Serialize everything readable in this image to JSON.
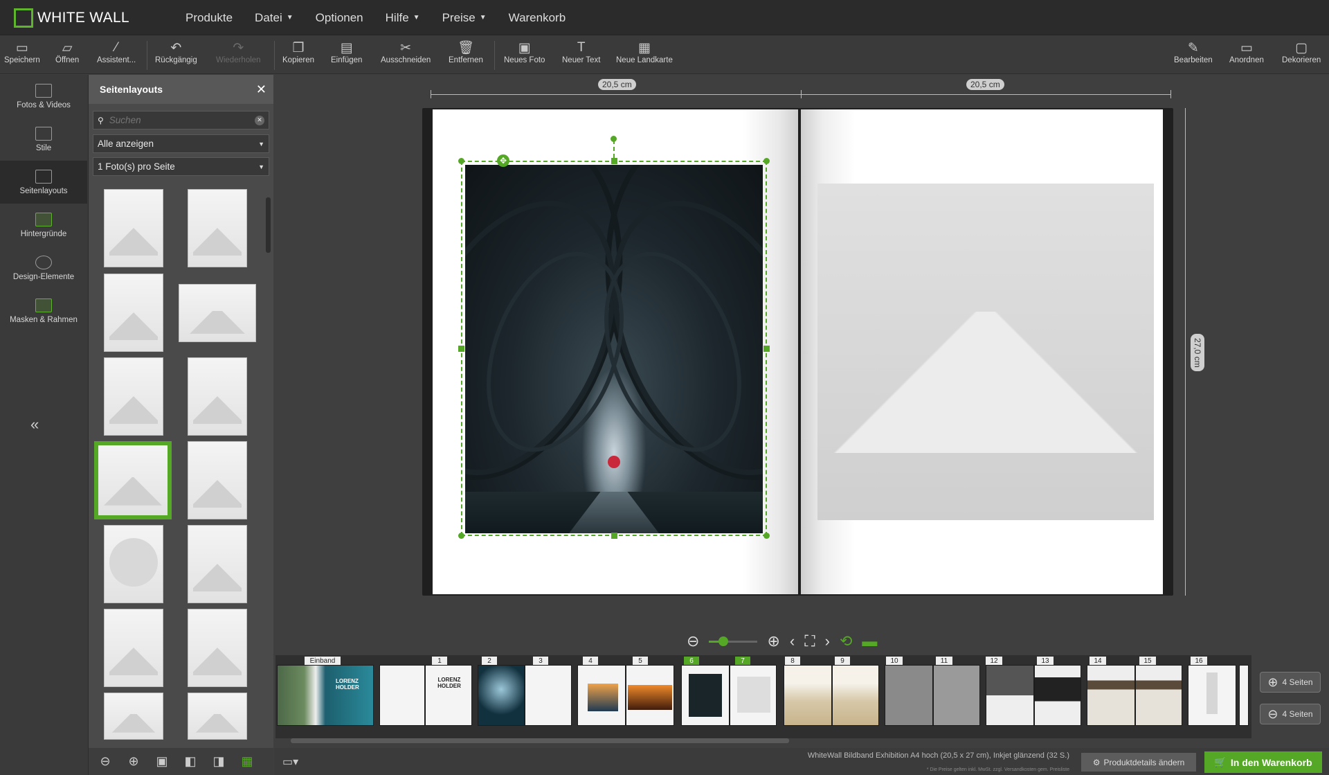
{
  "brand": {
    "name": "WHITE WALL",
    "accent": "#55a826"
  },
  "menu": [
    {
      "label": "Produkte",
      "dropdown": false
    },
    {
      "label": "Datei",
      "dropdown": true
    },
    {
      "label": "Optionen",
      "dropdown": false
    },
    {
      "label": "Hilfe",
      "dropdown": true
    },
    {
      "label": "Preise",
      "dropdown": true
    },
    {
      "label": "Warenkorb",
      "dropdown": false
    }
  ],
  "toolbar": {
    "save": "Speichern",
    "open": "Öffnen",
    "assistant": "Assistent...",
    "undo": "Rückgängig",
    "redo": "Wiederholen",
    "copy": "Kopieren",
    "paste": "Einfügen",
    "cut": "Ausschneiden",
    "remove": "Entfernen",
    "new_photo": "Neues Foto",
    "new_text": "Neuer Text",
    "new_map": "Neue Landkarte",
    "edit": "Bearbeiten",
    "arrange": "Anordnen",
    "decorate": "Dekorieren"
  },
  "leftnav": [
    {
      "label": "Fotos & Videos",
      "icon": "image-icon"
    },
    {
      "label": "Stile",
      "icon": "book-icon"
    },
    {
      "label": "Seitenlayouts",
      "icon": "layout-icon",
      "active": true
    },
    {
      "label": "Hintergründe",
      "icon": "background-icon"
    },
    {
      "label": "Design-Elemente",
      "icon": "shapes-icon"
    },
    {
      "label": "Masken & Rahmen",
      "icon": "frame-icon"
    }
  ],
  "collapse_glyph": "«",
  "panel": {
    "title": "Seitenlayouts",
    "search_placeholder": "Suchen",
    "filter_value": "Alle anzeigen",
    "photos_per_page_value": "1 Foto(s) pro Seite"
  },
  "rulers": {
    "left_width": "20,5 cm",
    "right_width": "20,5 cm",
    "height": "27,0 cm"
  },
  "filmstrip": {
    "cover_label": "Einband",
    "cover_text": "LORENZ HOLDER",
    "page1_text": "LORENZ HOLDER",
    "page_numbers": [
      "1",
      "2",
      "3",
      "4",
      "5",
      "6",
      "7",
      "8",
      "9",
      "10",
      "11",
      "12",
      "13",
      "14",
      "15",
      "16"
    ],
    "selected_pages": [
      "6",
      "7"
    ]
  },
  "page_buttons": {
    "add": "4 Seiten",
    "remove": "4 Seiten"
  },
  "status": {
    "product_info": "WhiteWall Bildband Exhibition A4 hoch (20,5 x 27 cm), Inkjet glänzend (32 S.)",
    "note": "* Die Preise gelten inkl. MwSt. zzgl. Versandkosten gem. Preisliste",
    "product_button": "Produktdetails ändern",
    "cart_button": "In den Warenkorb"
  }
}
